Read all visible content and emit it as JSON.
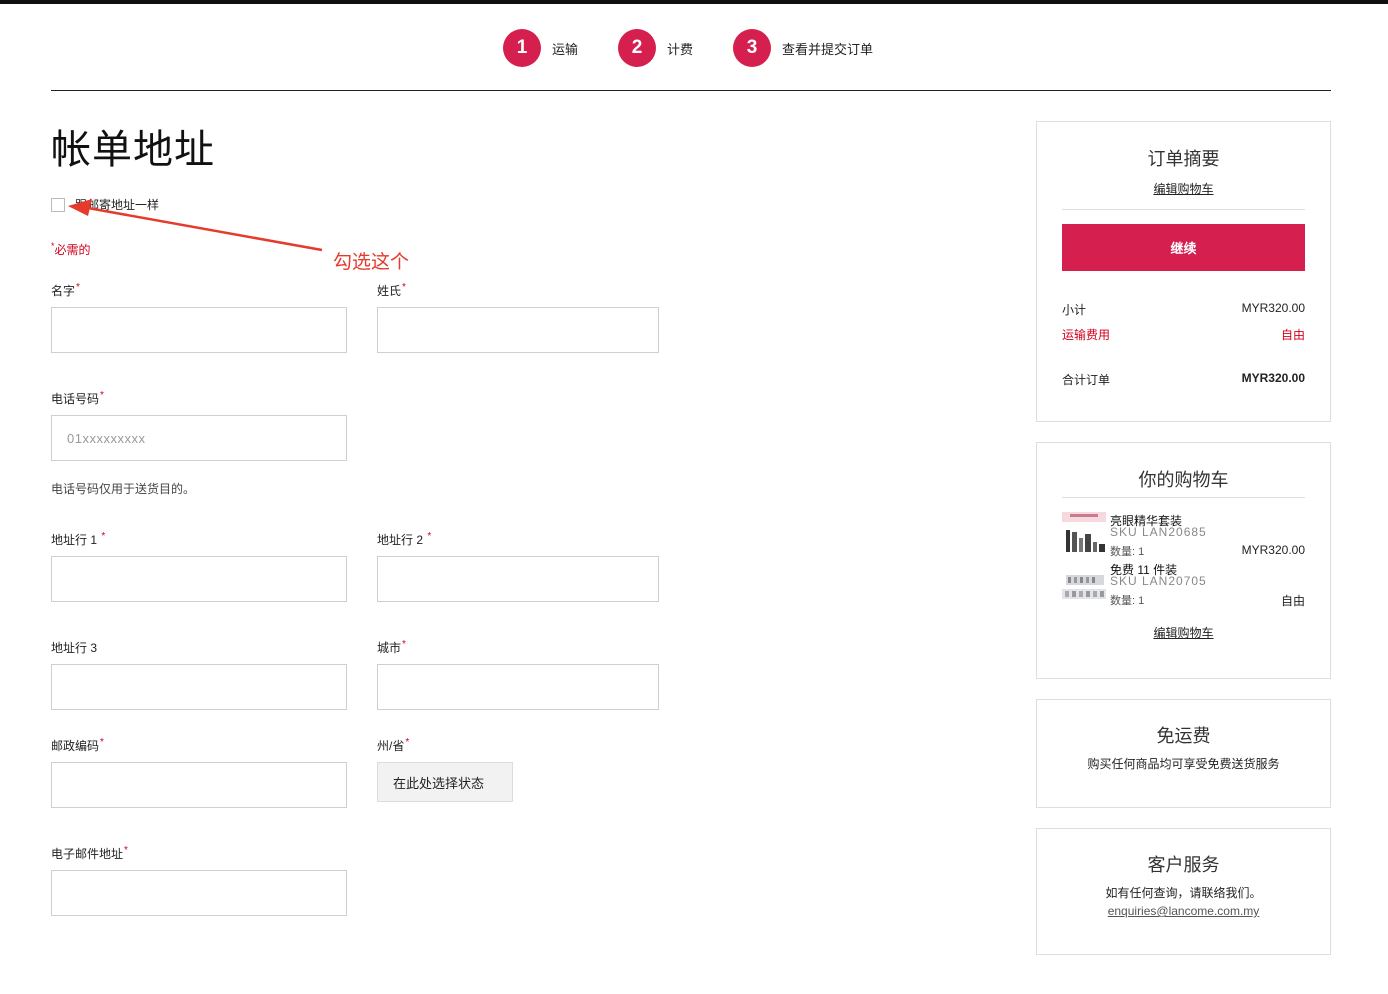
{
  "steps": [
    {
      "num": "1",
      "label": "运输"
    },
    {
      "num": "2",
      "label": "计费"
    },
    {
      "num": "3",
      "label": "查看并提交订单"
    }
  ],
  "page_title": "帐单地址",
  "same_as_shipping_label": "跟邮寄地址一样",
  "required_note": "必需的",
  "annotation": "勾选这个",
  "form": {
    "first_name_label": "名字",
    "last_name_label": "姓氏",
    "phone_label": "电话号码",
    "phone_placeholder": "01xxxxxxxxx",
    "phone_helper": "电话号码仅用于送货目的。",
    "address1_label": "地址行 1",
    "address2_label": "地址行 2",
    "address3_label": "地址行 3",
    "city_label": "城市",
    "postcode_label": "邮政编码",
    "state_label": "州/省",
    "state_select": "在此处选择状态",
    "email_label": "电子邮件地址",
    "required_star": "*"
  },
  "summary": {
    "title": "订单摘要",
    "edit_cart": "编辑购物车",
    "continue": "继续",
    "subtotal_label": "小计",
    "subtotal_value": "MYR320.00",
    "shipping_label": "运输费用",
    "shipping_value": "自由",
    "total_label": "合计订单",
    "total_value": "MYR320.00"
  },
  "cart": {
    "title": "你的购物车",
    "items": [
      {
        "name": "亮眼精华套装",
        "sku": "SKU LAN20685",
        "qty": "数量: 1",
        "price": "MYR320.00"
      },
      {
        "name": "免费 11 件装",
        "sku": "SKU LAN20705",
        "qty": "数量: 1",
        "price": "自由"
      }
    ],
    "edit_cart": "编辑购物车"
  },
  "free_shipping": {
    "title": "免运费",
    "text": "购买任何商品均可享受免费送货服务"
  },
  "customer_service": {
    "title": "客户服务",
    "text": "如有任何查询，请联络我们。",
    "email": "enquiries@lancome.com.my"
  },
  "colors": {
    "accent": "#d51f4f",
    "required": "#d0021b",
    "annotation": "#e53a2c"
  }
}
